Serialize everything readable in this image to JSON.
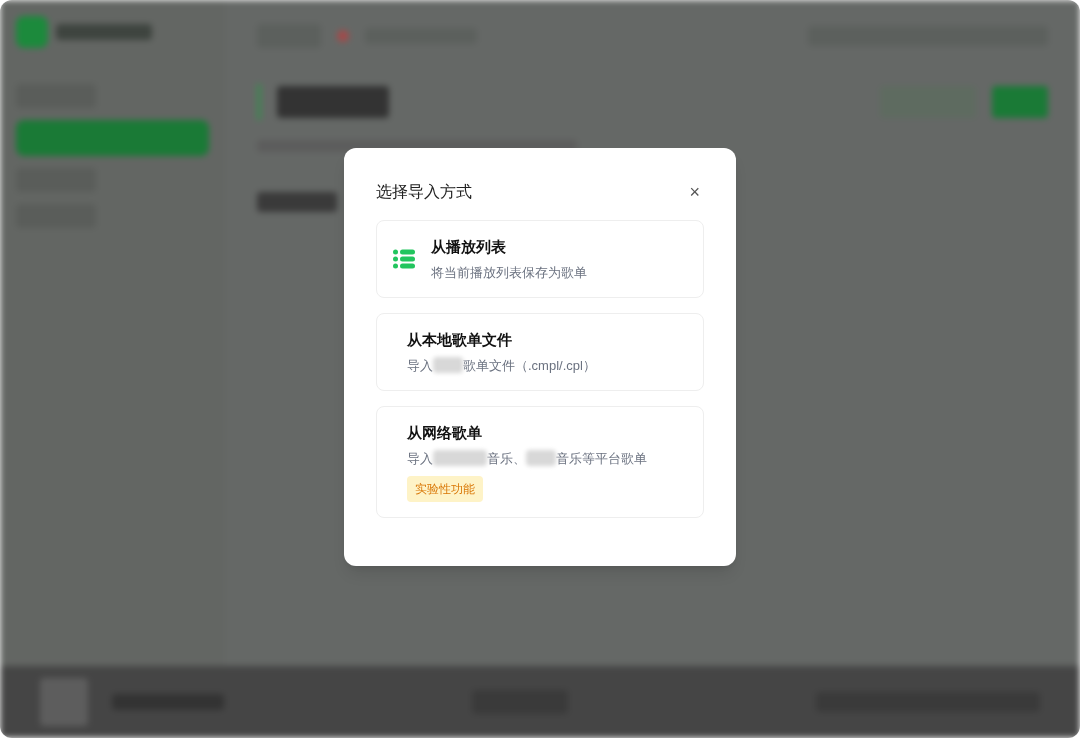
{
  "dialog": {
    "title": "选择导入方式",
    "close": "×",
    "options": [
      {
        "kind": "iconed",
        "title": "从播放列表",
        "description": [
          {
            "kind": "text",
            "text": "将当前播放列表保存为歌单"
          }
        ]
      },
      {
        "kind": "plain",
        "title": "从本地歌单文件",
        "description": [
          {
            "kind": "text",
            "text": "导入"
          },
          {
            "kind": "redacted"
          },
          {
            "kind": "text",
            "text": "歌单文件（.cmpl/.cpl）"
          }
        ]
      },
      {
        "kind": "plain",
        "title": "从网络歌单",
        "description": [
          {
            "kind": "text",
            "text": "导入"
          },
          {
            "kind": "wideredacted"
          },
          {
            "kind": "text",
            "text": "音乐、"
          },
          {
            "kind": "redacted"
          },
          {
            "kind": "text",
            "text": "音乐等平台歌单"
          }
        ],
        "badge": "实验性功能"
      }
    ]
  }
}
